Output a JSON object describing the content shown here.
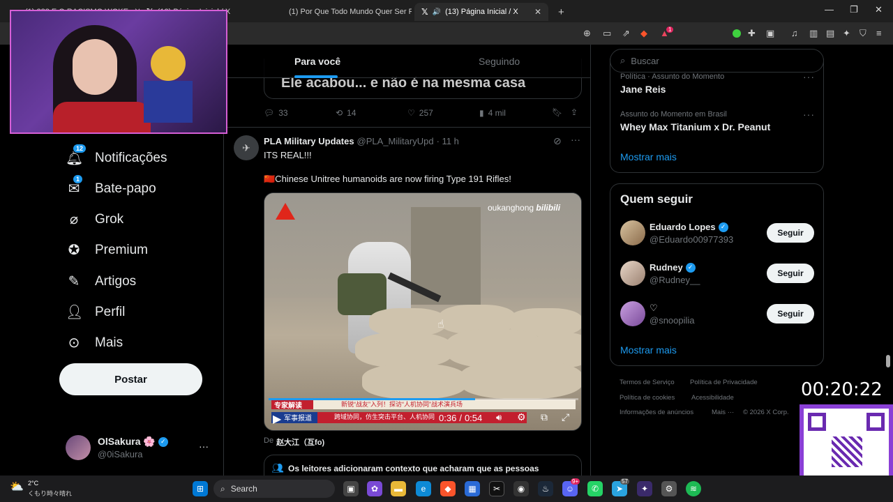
{
  "browser": {
    "tabs": [
      {
        "label": "(1) 288 E O RACISMO WOKE - YouTu",
        "icon": "youtube-icon"
      },
      {
        "label": "(13) Página Inicial / X",
        "icon": "x-icon"
      },
      {
        "label": "(1) Por Que Todo Mundo Quer Ser Fit",
        "icon": "youtube-icon"
      },
      {
        "label": "(13) Página Inicial / X",
        "icon": "x-icon"
      }
    ],
    "new_tab": "+",
    "extension_badge": "1"
  },
  "feed": {
    "tab_for_you": "Para você",
    "tab_following": "Seguindo",
    "prev_tweet_text": "Ele acabou... e não é na mesma casa",
    "prev_tweet_actions": {
      "replies": "33",
      "retweets": "14",
      "likes": "257",
      "views": "4 mil"
    }
  },
  "tweet": {
    "author": "PLA Military Updates",
    "handle": "@PLA_MilitaryUpd",
    "time": "· 11 h",
    "line1": "ITS REAL!!!",
    "line2": "🇨🇳Chinese Unitree humanoids are now firing Type 191 Rifles!",
    "video": {
      "watermark": "oukanghong",
      "watermark_brand": "bilibili",
      "caption_tag": "专家解读",
      "caption_main": "新锐“战友”入列！探访“人机协同”战术演兵场",
      "caption_sub_tag": "军事报道",
      "caption_sub": "跨域协同，仿生突击平台、人机协同",
      "time_current": "0:36",
      "time_total": "0:54",
      "progress": 0.667
    },
    "credit_prefix": "De",
    "credit": "赵大江（互fo)",
    "context_notice": "Os leitores adicionaram contexto que acharam que as pessoas"
  },
  "left_nav": {
    "items": [
      {
        "label": "Notificações",
        "icon": "bell-icon",
        "badge": "12"
      },
      {
        "label": "Bate-papo",
        "icon": "mail-icon",
        "badge": "1"
      },
      {
        "label": "Grok",
        "icon": "grok-icon"
      },
      {
        "label": "Premium",
        "icon": "premium-icon"
      },
      {
        "label": "Artigos",
        "icon": "article-icon"
      },
      {
        "label": "Perfil",
        "icon": "person-icon"
      },
      {
        "label": "Mais",
        "icon": "more-icon"
      }
    ],
    "post_button": "Postar",
    "account_name": "OlSakura 🌸",
    "account_handle": "@0iSakura",
    "account_more": "···"
  },
  "right": {
    "search_placeholder": "Buscar",
    "trends": [
      {
        "meta": "Política · Assunto do Momento",
        "name": "Jane Reis"
      },
      {
        "meta": "Assunto do Momento em Brasil",
        "name": "Whey Max Titanium x Dr. Peanut"
      }
    ],
    "show_more": "Mostrar mais",
    "who_to_follow_title": "Quem seguir",
    "who_to_follow": [
      {
        "name": "Eduardo Lopes",
        "handle": "@Eduardo00977393",
        "verified": true,
        "button": "Seguir"
      },
      {
        "name": "Rudney",
        "handle": "@Rudney__",
        "verified": true,
        "button": "Seguir"
      },
      {
        "name": "♡",
        "handle": "@snoopilia",
        "verified": false,
        "button": "Seguir"
      }
    ],
    "footer": {
      "terms": "Termos de Serviço",
      "privacy": "Política de Privacidade",
      "cookies": "Política de cookies",
      "accessibility": "Acessibilidade",
      "ads": "Informações de anúncios",
      "more": "Mais ···",
      "copyright": "© 2026 X Corp."
    }
  },
  "overlay": {
    "timer": "00:20:22"
  },
  "taskbar": {
    "weather_temp": "2°C",
    "weather_desc": "くもり時々晴れ",
    "search_label": "Search",
    "notif_badge_discord": "9+",
    "notif_badge_telegram": "57"
  },
  "colors": {
    "accent": "#1d9bf0",
    "background": "#000000",
    "divider": "#2f3336",
    "webcam_border": "#d65fd6"
  }
}
